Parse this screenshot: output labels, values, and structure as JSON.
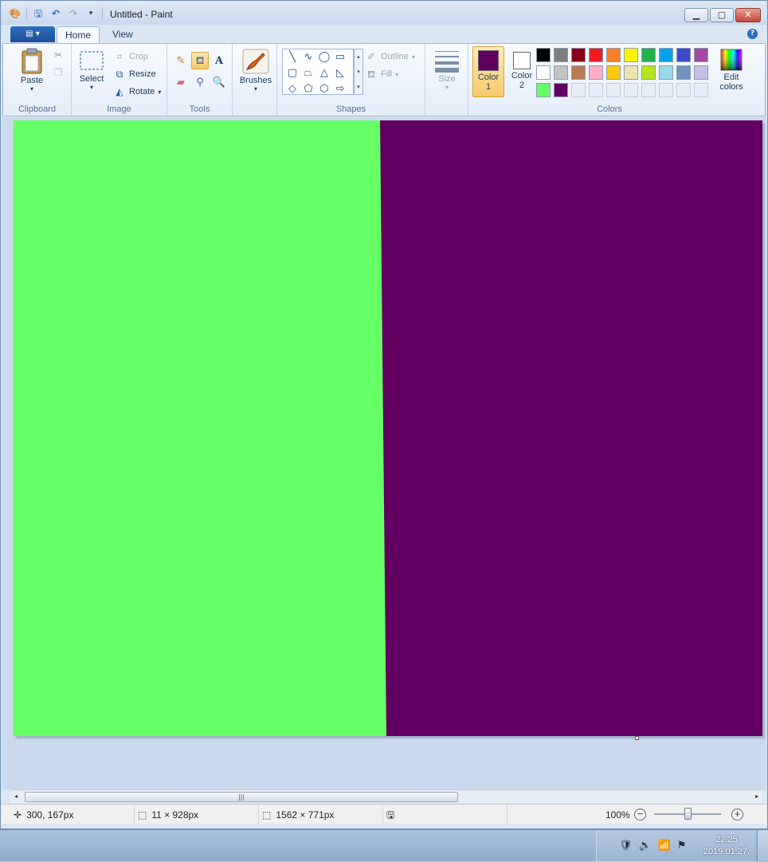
{
  "window": {
    "title": "Untitled - Paint"
  },
  "quick_access": [
    {
      "name": "paint-app-icon",
      "glyph": "🎨"
    },
    {
      "name": "save-icon",
      "glyph": "💾"
    },
    {
      "name": "undo-icon",
      "glyph": "↶"
    },
    {
      "name": "redo-icon",
      "glyph": "↷"
    },
    {
      "name": "customize-dropdown-icon",
      "glyph": "▾"
    }
  ],
  "tabs": {
    "home": "Home",
    "view": "View"
  },
  "ribbon": {
    "clipboard": {
      "label": "Clipboard",
      "paste": "Paste"
    },
    "image": {
      "label": "Image",
      "select": "Select",
      "crop": "Crop",
      "resize": "Resize",
      "rotate": "Rotate"
    },
    "tools": {
      "label": "Tools",
      "selected": "fill-tool"
    },
    "brushes": {
      "label": "Brushes"
    },
    "shapes": {
      "label": "Shapes",
      "outline": "Outline",
      "fill": "Fill"
    },
    "size": {
      "label": "Size"
    },
    "colors": {
      "label": "Colors",
      "color1_label": "Color",
      "color1_num": "1",
      "color2_label": "Color",
      "color2_num": "2",
      "color1_value": "#620061",
      "color2_value": "#ffffff",
      "edit_colors_line1": "Edit",
      "edit_colors_line2": "colors",
      "palette": [
        "#000000",
        "#7f7f7f",
        "#880015",
        "#ed1c24",
        "#ff7f27",
        "#fff200",
        "#22b14c",
        "#00a2e8",
        "#3f48cc",
        "#a349a4",
        "#ffffff",
        "#c3c3c3",
        "#b97a57",
        "#ffaec9",
        "#ffc90e",
        "#efe4b0",
        "#b5e61d",
        "#99d9ea",
        "#7092be",
        "#c8bfe7",
        "#66ff66",
        "#620061",
        "",
        "",
        "",
        "",
        "",
        "",
        "",
        ""
      ]
    }
  },
  "canvas": {
    "left_color": "#66ff66",
    "right_color": "#620061"
  },
  "status": {
    "cursor_pos": "300, 167px",
    "selection_size": "11 × 928px",
    "image_size": "1562 × 771px",
    "zoom": "100%"
  },
  "taskbar": {
    "time": "22:25",
    "date": "2019.01.27."
  }
}
